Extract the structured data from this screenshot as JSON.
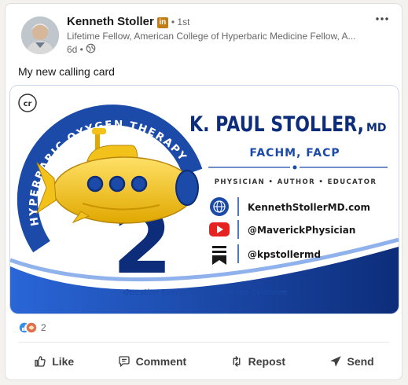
{
  "post": {
    "author": "Kenneth Stoller",
    "badge": "in",
    "degree": "• 1st",
    "headline": "Lifetime Fellow, American College of Hyperbaric Medicine Fellow, A...",
    "time": "6d •",
    "text": "My new calling card",
    "reaction_count": "2"
  },
  "card_image": {
    "ring_text": "HYPERBARIC OXYGEN THERAPY",
    "big_number": "2",
    "cr_badge": "cr",
    "name": "K. PAUL STOLLER,",
    "name_suffix": "MD",
    "credentials": "FACHM, FACP",
    "roles": "PHYSICIAN  •  AUTHOR  •  EDUCATOR",
    "website": "KennethStollerMD.com",
    "youtube": "@MaverickPhysician",
    "substack": "@kpstollermd",
    "tagline": "Question Everything. Follow the Evidence.",
    "colors": {
      "navy": "#0d2d7a",
      "blue": "#1b4aa8",
      "yellow": "#f2c21b",
      "red": "#e52421"
    }
  },
  "actions": {
    "like": "Like",
    "comment": "Comment",
    "repost": "Repost",
    "send": "Send"
  },
  "icons": [
    "globe-icon",
    "more-icon",
    "thumb-up-icon",
    "comment-icon",
    "repost-icon",
    "send-icon",
    "youtube-icon",
    "substack-icon"
  ]
}
